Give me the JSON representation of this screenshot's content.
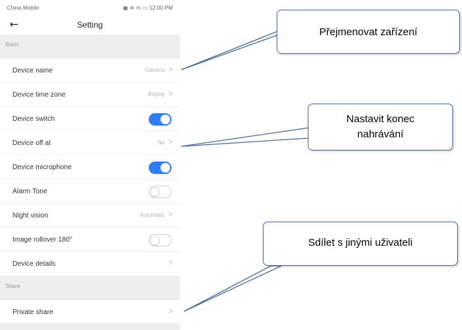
{
  "status_bar": {
    "carrier": "China Mobile",
    "indicators": "▣ ≋ ⁴⁄ₗₗ ▭ 12:00 PM"
  },
  "header": {
    "back_icon": "arrow-left-icon",
    "title": "Setting"
  },
  "sections": {
    "basic": "Basic",
    "share": "Share"
  },
  "rows": [
    {
      "label": "Device name",
      "value": "Camera",
      "type": "link"
    },
    {
      "label": "Device time zone",
      "value": "Beijing",
      "type": "link"
    },
    {
      "label": "Device switch",
      "type": "toggle",
      "on": true
    },
    {
      "label": "Device off at",
      "value": "No",
      "type": "link"
    },
    {
      "label": "Device microphone",
      "type": "toggle",
      "on": true
    },
    {
      "label": "Alarm Tone",
      "type": "toggle",
      "on": false
    },
    {
      "label": "Night vision",
      "value": "Automatic",
      "type": "link"
    },
    {
      "label": "Image rollover 180°",
      "type": "toggle",
      "on": false
    },
    {
      "label": "Device details",
      "value": "",
      "type": "link"
    },
    {
      "label": "Private share",
      "value": "",
      "type": "link"
    }
  ],
  "chevron": ">",
  "callouts": {
    "rename": "Přejmenovat zařízení",
    "end_recording_line1": "Nastavit konec",
    "end_recording_line2": "nahrávání",
    "share_users": "Sdílet s jinými uživateli"
  },
  "colors": {
    "toggle_on": "#2f7df6",
    "callout_border": "#4d6b92",
    "section_bg": "#eeeeee"
  }
}
